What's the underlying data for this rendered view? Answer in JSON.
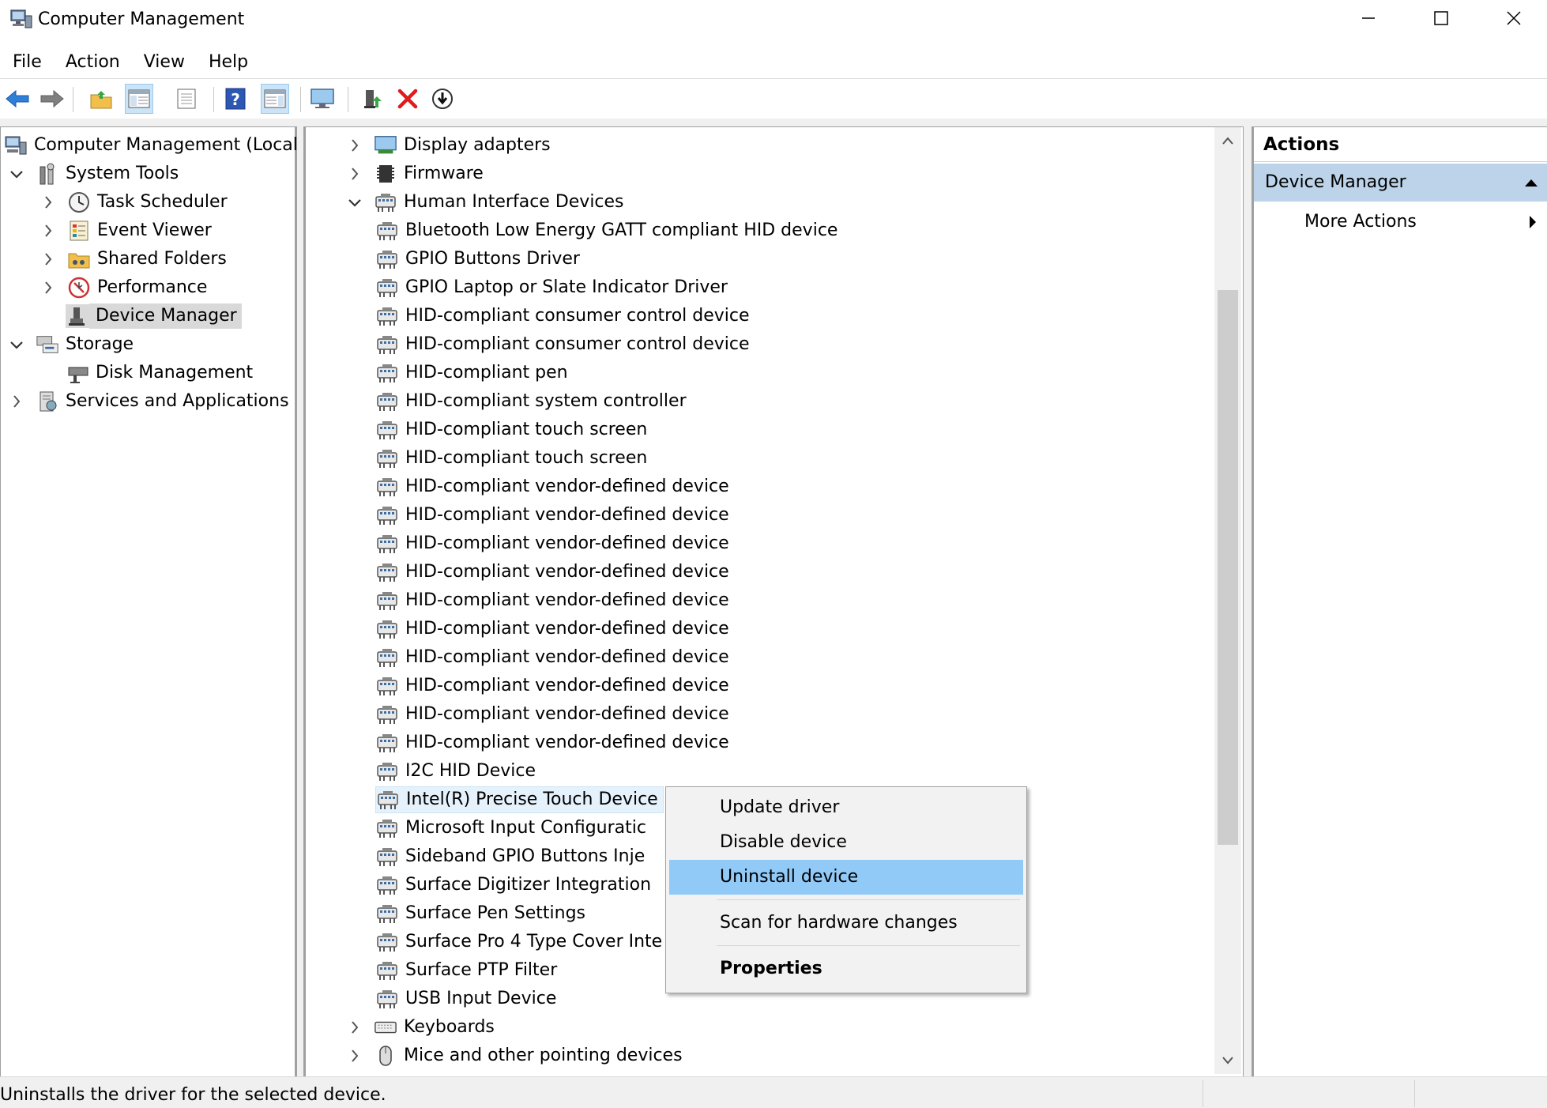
{
  "window": {
    "title": "Computer Management",
    "controls": [
      "minimize",
      "maximize",
      "close"
    ]
  },
  "menu": [
    "File",
    "Action",
    "View",
    "Help"
  ],
  "toolbar": [
    "back-arrow-icon",
    "forward-arrow-icon",
    "up-folder-icon",
    "show-hide-tree-icon",
    "properties-icon",
    "help-icon",
    "show-action-pane-icon",
    "monitor-icon",
    "update-driver-icon",
    "uninstall-icon",
    "download-icon"
  ],
  "tree": {
    "root": "Computer Management (Local)",
    "system_tools": "System Tools",
    "task_scheduler": "Task Scheduler",
    "event_viewer": "Event Viewer",
    "shared_folders": "Shared Folders",
    "performance": "Performance",
    "device_manager": "Device Manager",
    "storage": "Storage",
    "disk_management": "Disk Management",
    "services": "Services and Applications"
  },
  "devices": {
    "display_adapters": "Display adapters",
    "firmware": "Firmware",
    "hid": "Human Interface Devices",
    "hid_children": [
      "Bluetooth Low Energy GATT compliant HID device",
      "GPIO Buttons Driver",
      "GPIO Laptop or Slate Indicator Driver",
      "HID-compliant consumer control device",
      "HID-compliant consumer control device",
      "HID-compliant pen",
      "HID-compliant system controller",
      "HID-compliant touch screen",
      "HID-compliant touch screen",
      "HID-compliant vendor-defined device",
      "HID-compliant vendor-defined device",
      "HID-compliant vendor-defined device",
      "HID-compliant vendor-defined device",
      "HID-compliant vendor-defined device",
      "HID-compliant vendor-defined device",
      "HID-compliant vendor-defined device",
      "HID-compliant vendor-defined device",
      "HID-compliant vendor-defined device",
      "HID-compliant vendor-defined device",
      "I2C HID Device",
      "Intel(R) Precise Touch Device",
      "Microsoft Input Configuratic",
      "Sideband GPIO Buttons Inje",
      "Surface Digitizer Integration",
      "Surface Pen Settings",
      "Surface Pro 4 Type Cover Inte",
      "Surface PTP Filter",
      "USB Input Device"
    ],
    "keyboards": "Keyboards",
    "mice": "Mice and other pointing devices"
  },
  "actions": {
    "title": "Actions",
    "section": "Device Manager",
    "more": "More Actions"
  },
  "context_menu": {
    "update": "Update driver",
    "disable": "Disable device",
    "uninstall": "Uninstall device",
    "scan": "Scan for hardware changes",
    "properties": "Properties"
  },
  "status": "Uninstalls the driver for the selected device.",
  "colors": {
    "selection": "#d9d9d9",
    "context_highlight": "#91c9f7",
    "action_section": "#bcd3ea"
  }
}
